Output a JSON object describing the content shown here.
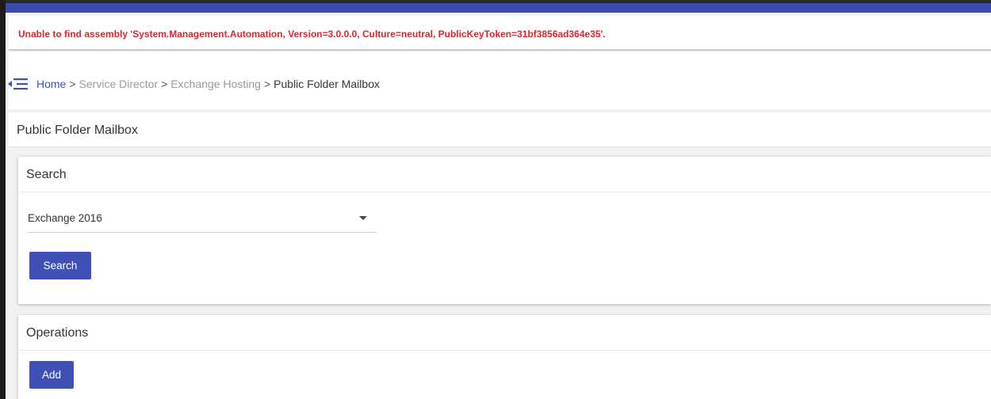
{
  "error": {
    "message": "Unable to find assembly 'System.Management.Automation, Version=3.0.0.0, Culture=neutral, PublicKeyToken=31bf3856ad364e35'."
  },
  "breadcrumb": {
    "home": "Home",
    "separator": ">",
    "service_director": "Service Director",
    "exchange_hosting": "Exchange Hosting",
    "current": "Public Folder Mailbox"
  },
  "page": {
    "title": "Public Folder Mailbox"
  },
  "search": {
    "title": "Search",
    "select_value": "Exchange 2016",
    "button_label": "Search"
  },
  "operations": {
    "title": "Operations",
    "add_label": "Add"
  },
  "colors": {
    "accent": "#3f51b5",
    "error": "#e0242a",
    "muted": "#9a9a9a"
  },
  "icons": {
    "menu_toggle": "menu-collapse-icon",
    "dropdown": "caret-down-icon"
  }
}
